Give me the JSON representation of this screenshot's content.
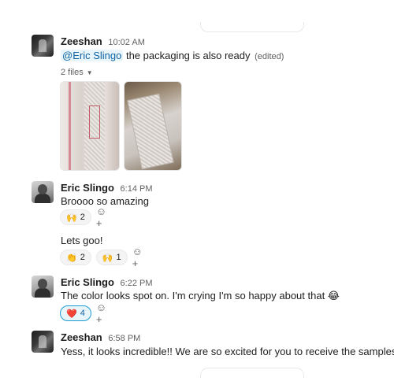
{
  "messages": [
    {
      "author": "Zeeshan",
      "time": "10:02 AM",
      "mention": "@Eric Slingo",
      "text": " the packaging is also ready",
      "edited": "(edited)",
      "files_label": "2 files"
    },
    {
      "author": "Eric Slingo",
      "time": "6:14 PM",
      "text": "Broooo so amazing",
      "reactions": [
        {
          "emoji": "🙌",
          "count": "2"
        }
      ],
      "followup_text": "Lets goo!",
      "followup_reactions": [
        {
          "emoji": "👏",
          "count": "2"
        },
        {
          "emoji": "🙌",
          "count": "1"
        }
      ]
    },
    {
      "author": "Eric Slingo",
      "time": "6:22 PM",
      "text": "The color looks spot on. I'm crying I'm so happy about that 😂",
      "reactions": [
        {
          "emoji": "❤️",
          "count": "4"
        }
      ]
    },
    {
      "author": "Zeeshan",
      "time": "6:58 PM",
      "text": "Yess, it looks incredible!! We are so excited for you to receive the samples"
    }
  ],
  "add_reaction_icon": "☺+"
}
